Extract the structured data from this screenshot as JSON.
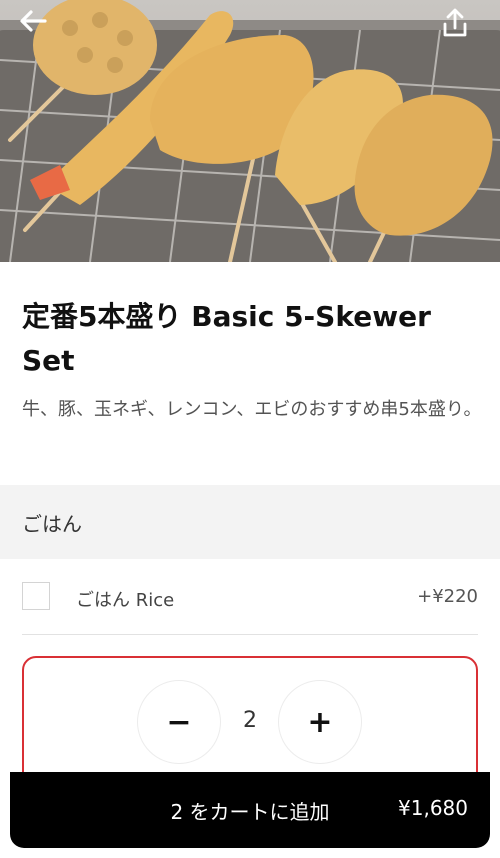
{
  "header": {
    "back_icon": "arrow-left-icon",
    "share_icon": "share-icon"
  },
  "item": {
    "title": "定番5本盛り Basic 5-Skewer Set",
    "description": "牛、豚、玉ネギ、レンコン、エビのおすすめ串5本盛り。"
  },
  "section": {
    "title": "ごはん",
    "options": [
      {
        "label": "ごはん Rice",
        "price": "+¥220",
        "checked": false
      }
    ]
  },
  "quantity": {
    "value": "2",
    "minus_label": "−",
    "plus_label": "+"
  },
  "cart": {
    "add_label": "2 をカートに追加",
    "total": "¥1,680"
  }
}
